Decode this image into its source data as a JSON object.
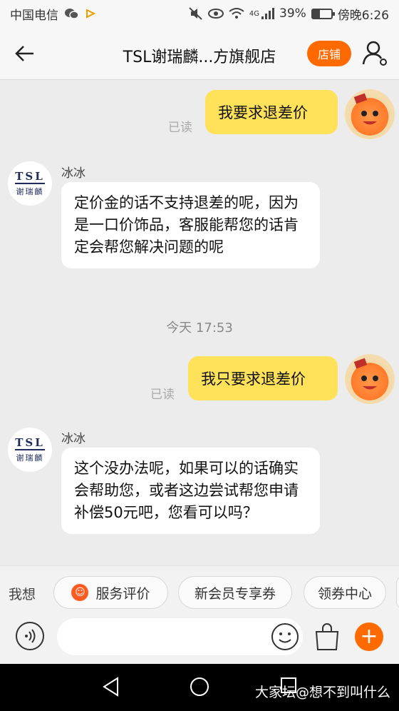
{
  "status_bar": {
    "carrier": "中国电信",
    "network_type": "4G",
    "battery_percent": "39%",
    "battery_level": 0.39,
    "time": "傍晚6:26"
  },
  "nav": {
    "title": "TSL谢瑞麟...方旗舰店",
    "shop_label": "店铺",
    "icons": [
      "back-arrow-icon",
      "user-settings-icon"
    ]
  },
  "chat": {
    "messages": [
      {
        "side": "right",
        "text": "我要求退差价",
        "read": "已读"
      },
      {
        "side": "left",
        "sender": "冰冰",
        "text": "定价金的话不支持退差的呢，因为是一口价饰品，客服能帮您的话肯定会帮您解决问题的呢"
      },
      {
        "side": "separator",
        "text": "今天  17:53"
      },
      {
        "side": "right",
        "text": "我只要求退差价",
        "read": "已读"
      },
      {
        "side": "left",
        "sender": "冰冰",
        "text": "这个没办法呢，如果可以的话确实会帮助您，或者这边尝试帮您申请补偿50元吧，您看可以吗？"
      }
    ],
    "shop_avatar": {
      "line1": "TSL",
      "line2": "谢瑞麟"
    }
  },
  "quick_replies": {
    "label": "我想",
    "chips": [
      "服务评价",
      "新会员专享券",
      "领券中心"
    ]
  },
  "input": {
    "placeholder": ""
  },
  "watermark": "大家坛@想不到叫什么",
  "colors": {
    "accent": "#ff6a00",
    "bubble_right": "#ffe15a",
    "bubble_left": "#ffffff"
  }
}
